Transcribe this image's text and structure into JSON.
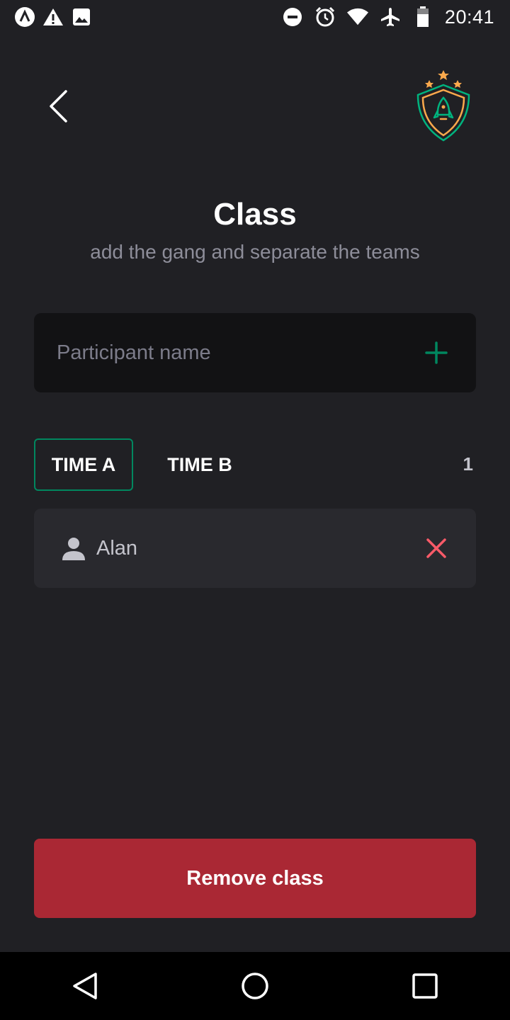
{
  "status_bar": {
    "time": "20:41",
    "left_icons": [
      "app-icon",
      "warning-icon",
      "image-icon"
    ],
    "right_icons": [
      "dnd-icon",
      "alarm-icon",
      "wifi-icon",
      "airplane-icon",
      "battery-icon"
    ]
  },
  "header": {
    "back_icon": "chevron-left-icon",
    "logo_icon": "rocket-shield-logo"
  },
  "page": {
    "title": "Class",
    "subtitle": "add the gang and separate the teams"
  },
  "participant_input": {
    "placeholder": "Participant name",
    "value": "",
    "add_icon": "plus-icon"
  },
  "tabs": [
    {
      "label": "TIME A",
      "selected": true
    },
    {
      "label": "TIME B",
      "selected": false
    }
  ],
  "player_count": "1",
  "players": [
    {
      "name": "Alan",
      "icon": "user-icon",
      "remove_icon": "close-icon"
    }
  ],
  "remove_class_button": {
    "label": "Remove class"
  },
  "colors": {
    "background": "#202024",
    "input_bg": "#121214",
    "card_bg": "#29292e",
    "accent_green": "#00875f",
    "danger_red": "#aa2834",
    "close_red": "#f75a68",
    "subtitle_gray": "#8d8d99"
  },
  "nav_bar": {
    "buttons": [
      "back-nav-icon",
      "home-nav-icon",
      "recents-nav-icon"
    ]
  }
}
